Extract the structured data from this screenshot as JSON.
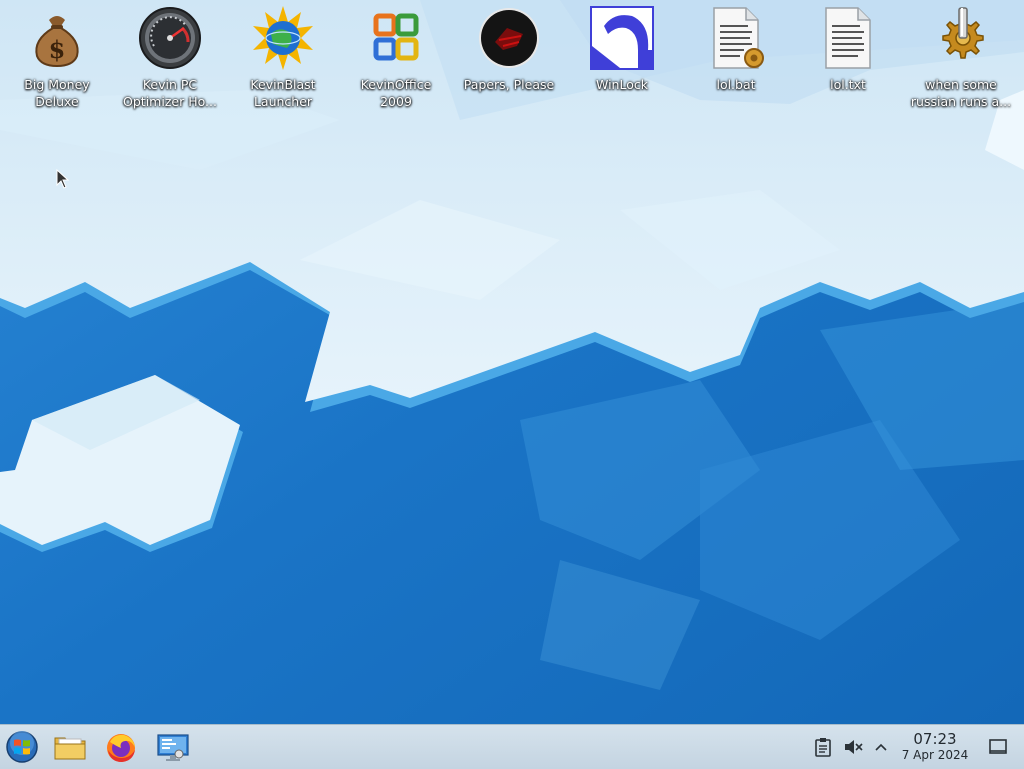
{
  "desktop": {
    "icons": [
      {
        "label": "Big Money\nDeluxe",
        "icon": "money-bag-icon"
      },
      {
        "label": "Kevin PC\nOptimizer Ho...",
        "icon": "speedometer-icon"
      },
      {
        "label": "KevinBlast\nLauncher",
        "icon": "globe-sun-icon"
      },
      {
        "label": "KevinOffice\n2009",
        "icon": "office-logo-icon"
      },
      {
        "label": "Papers, Please",
        "icon": "papers-please-icon"
      },
      {
        "label": "WinLock",
        "icon": "winlock-icon"
      },
      {
        "label": "lol.bat",
        "icon": "batch-file-icon"
      },
      {
        "label": "lol.txt",
        "icon": "text-file-icon"
      },
      {
        "label": "when some\nrussian runs a...",
        "icon": "gear-icon"
      }
    ]
  },
  "taskbar": {
    "apps": [
      {
        "name": "start-menu-button",
        "icon": "windows-orb-icon"
      },
      {
        "name": "file-manager-button",
        "icon": "folder-icon"
      },
      {
        "name": "firefox-button",
        "icon": "firefox-icon"
      },
      {
        "name": "system-settings-button",
        "icon": "monitor-settings-icon"
      }
    ],
    "tray": {
      "clipboard_icon": "clipboard-icon",
      "volume_icon": "speaker-muted-icon",
      "expand_icon": "chevron-up-icon",
      "show_desktop_icon": "show-desktop-icon"
    },
    "clock": {
      "time": "07:23",
      "date": "7 Apr 2024"
    }
  },
  "colors": {
    "wallpaper_deep_blue": "#1a78c8",
    "wallpaper_ice": "#d6ecf8",
    "taskbar": "#c9d8e4"
  }
}
